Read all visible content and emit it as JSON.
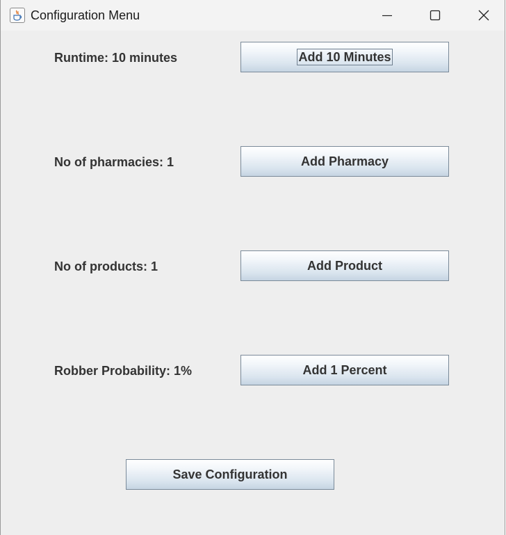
{
  "window": {
    "title": "Configuration Menu",
    "app_icon": "java-cup-icon",
    "controls": {
      "minimize_icon": "minimize-icon",
      "maximize_icon": "maximize-icon",
      "close_icon": "close-icon"
    }
  },
  "config": {
    "runtime_label": "Runtime: 10 minutes",
    "runtime_button": "Add 10 Minutes",
    "pharmacies_label": "No of pharmacies: 1",
    "pharmacies_button": "Add Pharmacy",
    "products_label": "No of products: 1",
    "products_button": "Add Product",
    "robber_label": "Robber Probability: 1%",
    "robber_button": "Add 1 Percent",
    "save_button": "Save Configuration"
  },
  "colors": {
    "window_bg": "#eeeeee",
    "titlebar_bg": "#f3f3f3",
    "text": "#333333",
    "button_border": "#7a8a99",
    "button_gradient_bottom": "#c5d4e2"
  }
}
